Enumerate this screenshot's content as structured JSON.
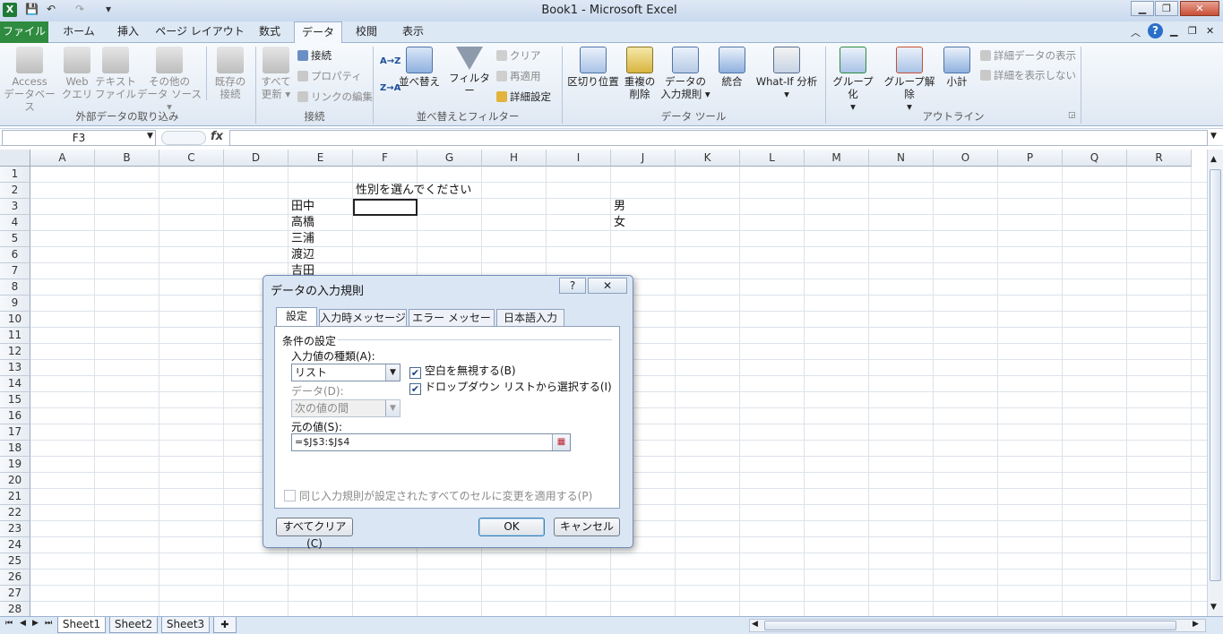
{
  "window": {
    "title": "Book1  -  Microsoft Excel"
  },
  "quick_access": {
    "dropdown": "▾"
  },
  "tabs": [
    "ファイル",
    "ホーム",
    "挿入",
    "ページ レイアウト",
    "数式",
    "データ",
    "校閲",
    "表示"
  ],
  "ribbon": {
    "access": "Access\nデータベース",
    "web": "Web\nクエリ",
    "text_file": "テキスト\nファイル",
    "other_sources": "その他の\nデータ ソース ▾",
    "existing": "既存の\n接続",
    "refresh_all": "すべて\n更新 ▾",
    "connections": "接続",
    "properties": "プロパティ",
    "edit_links": "リンクの編集",
    "sort_az": "A→Z",
    "sort_za": "Z→A",
    "sort": "並べ替え",
    "filter": "フィルター",
    "clear": "クリア",
    "reapply": "再適用",
    "advanced": "詳細設定",
    "text_to_columns": "区切り位置",
    "remove_duplicates": "重複の\n削除",
    "data_validation": "データの\n入力規則 ▾",
    "consolidate": "統合",
    "whatif": "What-If 分析\n▾",
    "group": "グループ化\n▾",
    "ungroup": "グループ解除\n▾",
    "subtotal": "小計",
    "show_detail": "詳細データの表示",
    "hide_detail": "詳細を表示しない",
    "groups": [
      "外部データの取り込み",
      "接続",
      "並べ替えとフィルター",
      "データ ツール",
      "アウトライン"
    ]
  },
  "formula_bar": {
    "name_box": "F3",
    "fx": "fx",
    "value": ""
  },
  "columns": [
    "A",
    "B",
    "C",
    "D",
    "E",
    "F",
    "G",
    "H",
    "I",
    "J",
    "K",
    "L",
    "M",
    "N",
    "O",
    "P",
    "Q",
    "R"
  ],
  "rows": [
    "1",
    "2",
    "3",
    "4",
    "5",
    "6",
    "7",
    "8",
    "9",
    "10",
    "11",
    "12",
    "13",
    "14",
    "15",
    "16",
    "17",
    "18",
    "19",
    "20",
    "21",
    "22",
    "23",
    "24",
    "25",
    "26",
    "27",
    "28"
  ],
  "cells": {
    "F2": "性別を選んでください",
    "E3": "田中",
    "E4": "高橋",
    "E5": "三浦",
    "E6": "渡辺",
    "E7": "吉田",
    "J3": "男",
    "J4": "女"
  },
  "sheets": [
    "Sheet1",
    "Sheet2",
    "Sheet3"
  ],
  "dialog": {
    "title": "データの入力規則",
    "help": "?",
    "close": "✕",
    "tabs": [
      "設定",
      "入力時メッセージ",
      "エラー メッセージ",
      "日本語入力"
    ],
    "section": "条件の設定",
    "allow_label": "入力値の種類(A):",
    "allow_value": "リスト",
    "ignore_blank": "空白を無視する(B)",
    "dropdown": "ドロップダウン リストから選択する(I)",
    "data_label": "データ(D):",
    "data_value": "次の値の間",
    "source_label": "元の値(S):",
    "source_value": "=$J$3:$J$4",
    "apply_all": "同じ入力規則が設定されたすべてのセルに変更を適用する(P)",
    "clear_all": "すべてクリア(C)",
    "ok": "OK",
    "cancel": "キャンセル"
  }
}
